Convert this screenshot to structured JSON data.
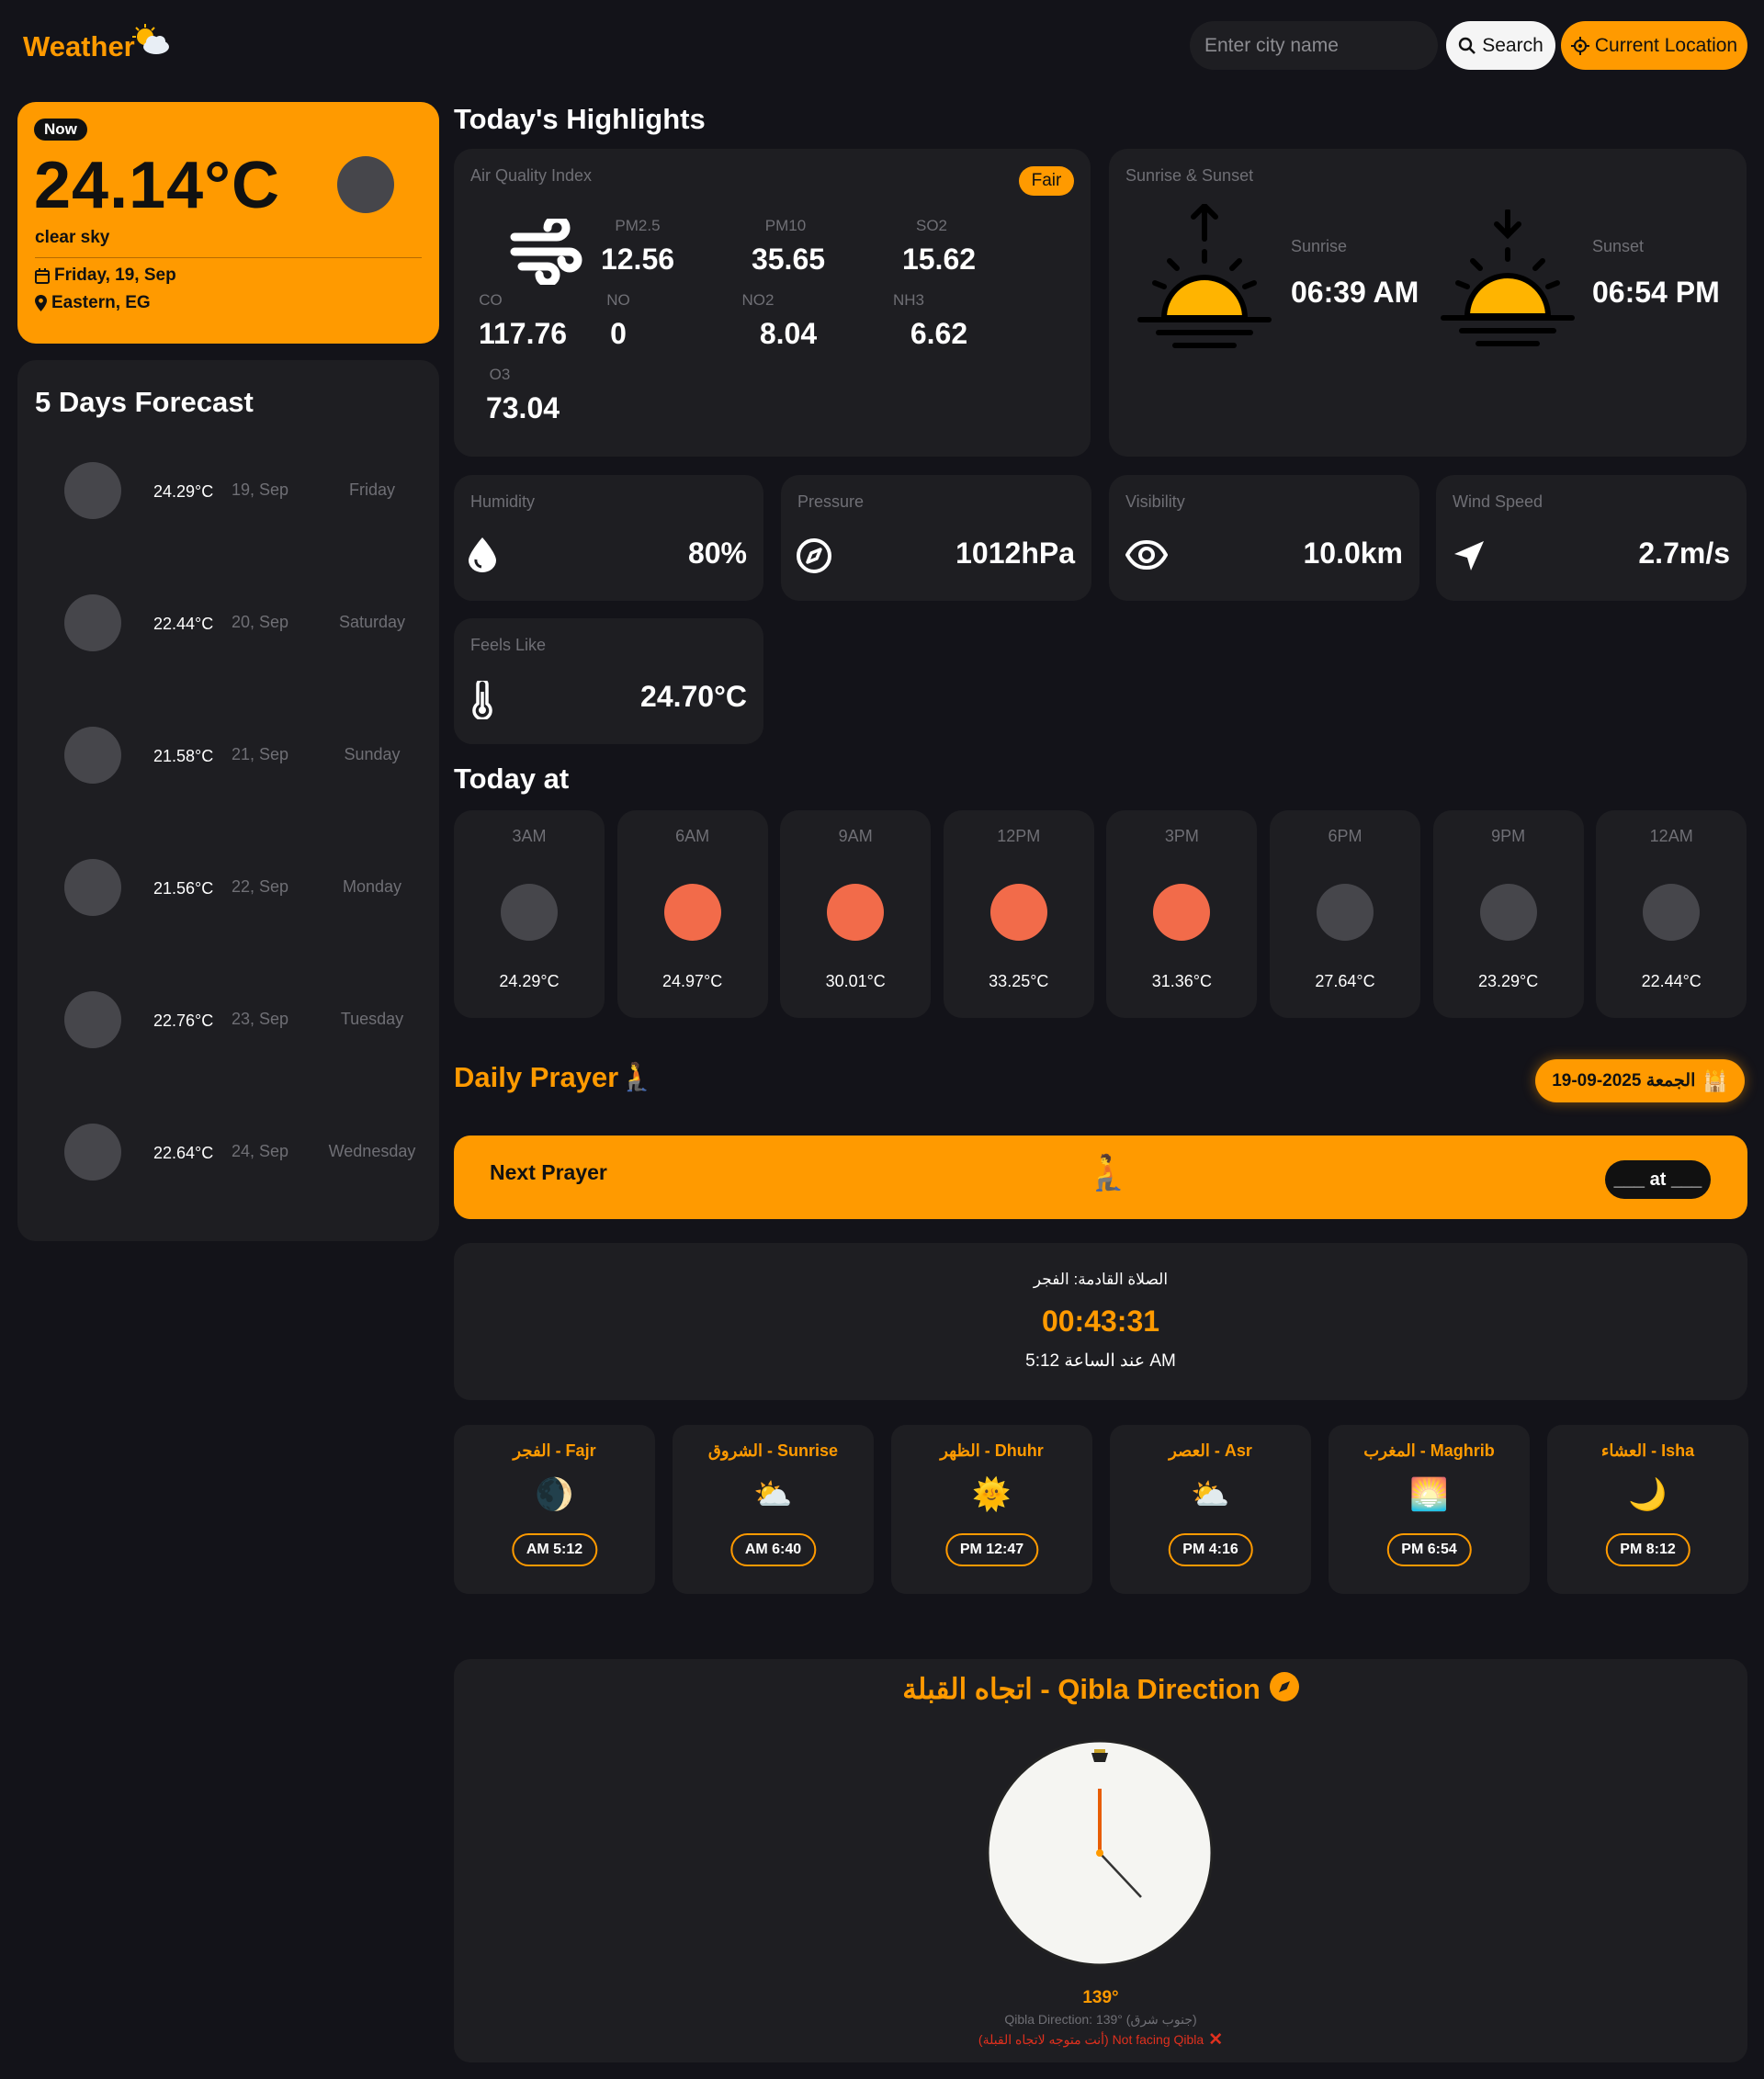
{
  "header": {
    "logo": "Weather",
    "search_placeholder": "Enter city name",
    "search_label": "Search",
    "location_label": "Current Location"
  },
  "now": {
    "badge": "Now",
    "temp": "24.14°C",
    "desc": "clear sky",
    "date": "Friday, 19, Sep",
    "location": "Eastern, EG"
  },
  "forecast": {
    "title": "5 Days Forecast",
    "days": [
      {
        "temp": "24.29°C",
        "date": "19, Sep",
        "day": "Friday"
      },
      {
        "temp": "22.44°C",
        "date": "20, Sep",
        "day": "Saturday"
      },
      {
        "temp": "21.58°C",
        "date": "21, Sep",
        "day": "Sunday"
      },
      {
        "temp": "21.56°C",
        "date": "22, Sep",
        "day": "Monday"
      },
      {
        "temp": "22.76°C",
        "date": "23, Sep",
        "day": "Tuesday"
      },
      {
        "temp": "22.64°C",
        "date": "24, Sep",
        "day": "Wednesday"
      }
    ]
  },
  "highlights": {
    "title": "Today's Highlights",
    "aqi": {
      "label": "Air Quality Index",
      "status": "Fair",
      "pm25": {
        "name": "PM2.5",
        "value": "12.56"
      },
      "pm10": {
        "name": "PM10",
        "value": "35.65"
      },
      "so2": {
        "name": "SO2",
        "value": "15.62"
      },
      "co": {
        "name": "CO",
        "value": "117.76"
      },
      "no": {
        "name": "NO",
        "value": "0"
      },
      "no2": {
        "name": "NO2",
        "value": "8.04"
      },
      "nh3": {
        "name": "NH3",
        "value": "6.62"
      },
      "o3": {
        "name": "O3",
        "value": "73.04"
      }
    },
    "sun": {
      "label": "Sunrise & Sunset",
      "sunrise_label": "Sunrise",
      "sunrise": "06:39 AM",
      "sunset_label": "Sunset",
      "sunset": "06:54 PM"
    },
    "humidity": {
      "label": "Humidity",
      "value": "80%"
    },
    "pressure": {
      "label": "Pressure",
      "value": "1012hPa"
    },
    "visibility": {
      "label": "Visibility",
      "value": "10.0km"
    },
    "wind": {
      "label": "Wind Speed",
      "value": "2.7m/s"
    },
    "feels": {
      "label": "Feels Like",
      "value": "24.70°C"
    }
  },
  "today": {
    "title": "Today at",
    "hours": [
      {
        "time": "3AM",
        "temp": "24.29°C",
        "icon": "moon-icon"
      },
      {
        "time": "6AM",
        "temp": "24.97°C",
        "icon": "sun-icon"
      },
      {
        "time": "9AM",
        "temp": "30.01°C",
        "icon": "sun-icon"
      },
      {
        "time": "12PM",
        "temp": "33.25°C",
        "icon": "sun-icon"
      },
      {
        "time": "3PM",
        "temp": "31.36°C",
        "icon": "sun-icon"
      },
      {
        "time": "6PM",
        "temp": "27.64°C",
        "icon": "moon-icon"
      },
      {
        "time": "9PM",
        "temp": "23.29°C",
        "icon": "moon-icon"
      },
      {
        "time": "12AM",
        "temp": "22.44°C",
        "icon": "moon-icon"
      }
    ]
  },
  "prayer": {
    "title": "Daily Prayer",
    "date_badge": "الجمعة 2025-09-19",
    "next_label": "Next Prayer",
    "next_pill": "___ at ___",
    "countdown": {
      "title": "الصلاة القادمة: الفجر",
      "time": "00:43:31",
      "at": "عند الساعة 5:12 AM"
    },
    "times": [
      {
        "name": "الفجر - Fajr",
        "icon": "🌒",
        "time": "AM 5:12"
      },
      {
        "name": "الشروق - Sunrise",
        "icon": "⛅",
        "time": "AM 6:40"
      },
      {
        "name": "الظهر - Dhuhr",
        "icon": "🌞",
        "time": "PM 12:47"
      },
      {
        "name": "العصر - Asr",
        "icon": "⛅",
        "time": "PM 4:16"
      },
      {
        "name": "المغرب - Maghrib",
        "icon": "🌅",
        "time": "PM 6:54"
      },
      {
        "name": "العشاء - Isha",
        "icon": "🌙",
        "time": "PM 8:12"
      }
    ]
  },
  "qibla": {
    "title": "اتجاه القبلة - Qibla Direction",
    "degrees": "139°",
    "direction": "Qibla Direction: 139° (جنوب شرق)",
    "status": "(أنت متوجه لاتجاه القبلة) Not facing Qibla",
    "angle": 139
  },
  "colors": {
    "accent": "#ff9a00",
    "bg": "#131319",
    "card": "#1e1e22",
    "sun": "#f26b4a",
    "moon": "#46464b",
    "error": "#e0301e"
  }
}
